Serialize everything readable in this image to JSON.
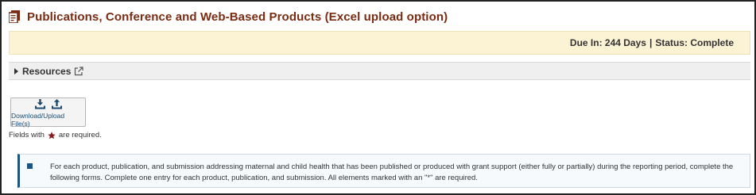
{
  "page": {
    "title": "Publications, Conference and Web-Based Products (Excel upload option)"
  },
  "status": {
    "due": "Due In: 244 Days",
    "separator": "|",
    "status": "Status: Complete"
  },
  "resources": {
    "label": "Resources"
  },
  "download_upload": {
    "label": "Download/Upload File(s)"
  },
  "required_note": {
    "prefix": "Fields with",
    "suffix": "are required."
  },
  "info": {
    "text": "For each product, publication, and submission addressing maternal and child health that has been published or produced with grant support (either fully or partially) during the reporting period, complete the following forms. Complete one entry for each product, publication, and submission. All elements marked with an \"*\" are required."
  },
  "colors": {
    "title": "#7a2b12",
    "status_bg": "#fcf2d4",
    "accent": "#1d5582",
    "required_star": "#8b1a1a"
  },
  "icons": [
    "document-icon",
    "caret-right-icon",
    "external-link-icon",
    "download-icon",
    "upload-icon",
    "star-icon",
    "info-bullet-icon"
  ]
}
